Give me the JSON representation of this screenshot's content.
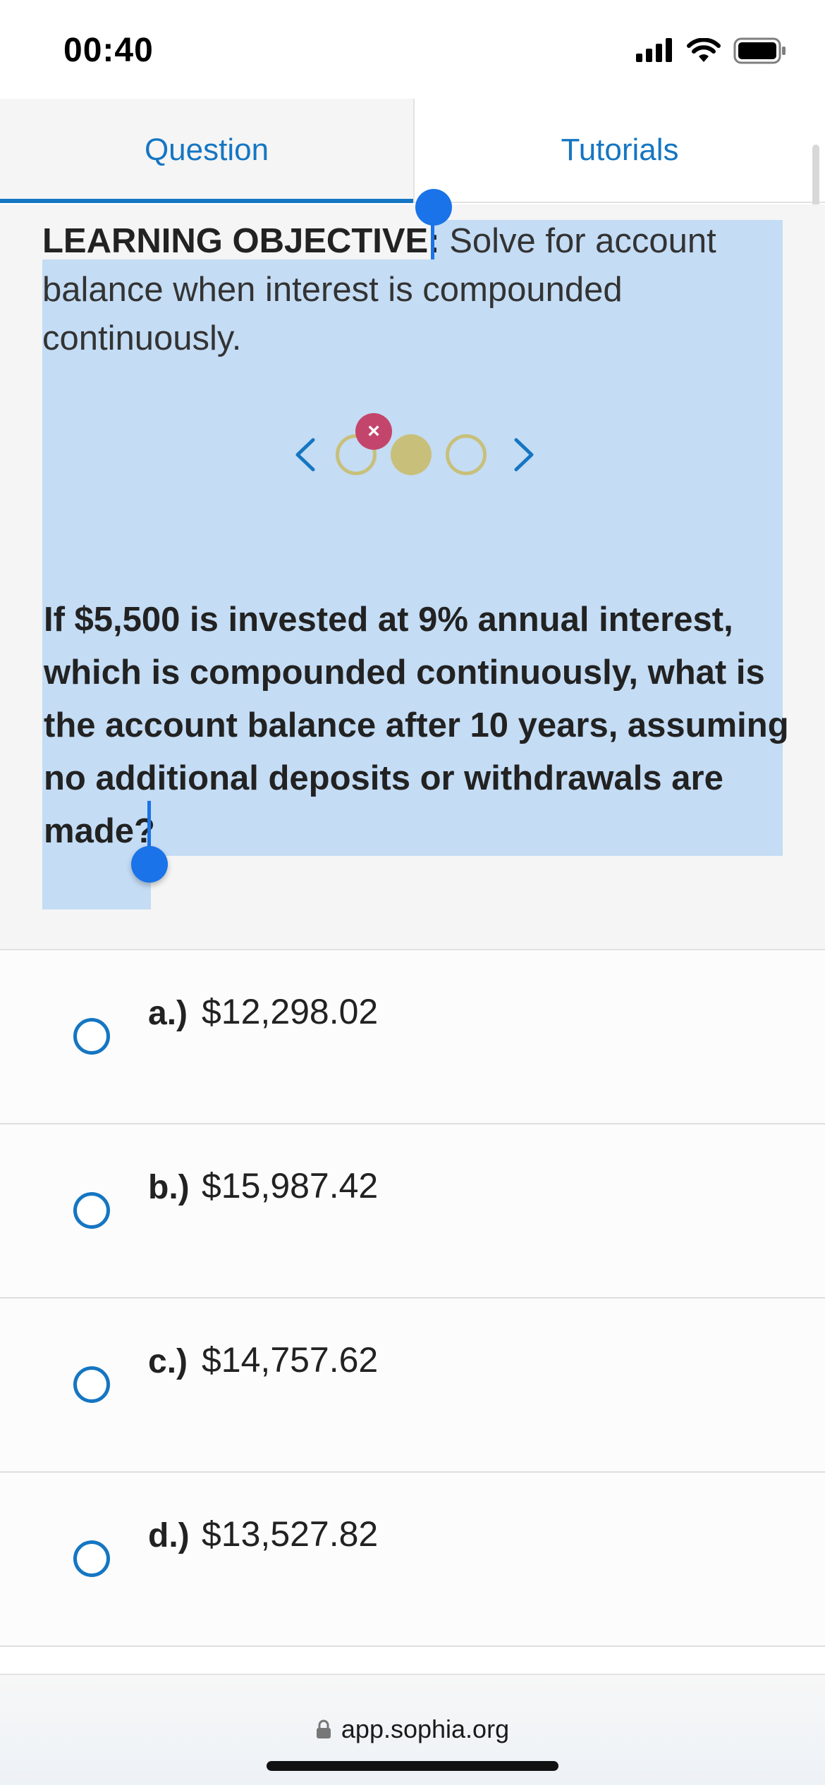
{
  "status_bar": {
    "time": "00:40",
    "icons": [
      "cellular-signal-icon",
      "wifi-icon",
      "battery-icon"
    ]
  },
  "tabs": [
    {
      "label": "Question",
      "active": true
    },
    {
      "label": "Tutorials",
      "active": false
    }
  ],
  "question": {
    "objective_label": "LEARNING OBJECTIVE:",
    "objective_text": "Solve for account balance when interest is compounded continuously.",
    "carousel": {
      "current_index": 2,
      "total": 3,
      "incorrect_badge": "×"
    },
    "prompt": "If $5,500 is invested at 9% annual interest, which is compounded continuously, what is the account balance after 10 years, assuming no additional deposits or withdrawals are made?"
  },
  "options": [
    {
      "letter": "a.)",
      "value": "$12,298.02"
    },
    {
      "letter": "b.)",
      "value": "$15,987.42"
    },
    {
      "letter": "c.)",
      "value": "$14,757.62"
    },
    {
      "letter": "d.)",
      "value": "$13,527.82"
    }
  ],
  "browser": {
    "url": "app.sophia.org"
  },
  "colors": {
    "accent": "#1576c2",
    "selection": "#c4dcf4",
    "selection_handle": "#1a73e8",
    "carousel_dot": "#c8c07a",
    "incorrect_badge": "#c4456b"
  }
}
